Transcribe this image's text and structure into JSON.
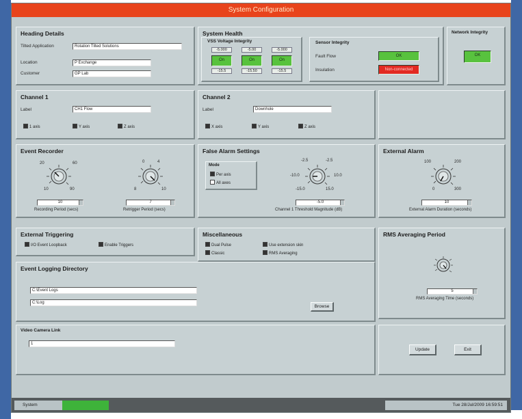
{
  "window": {
    "title": "System Configuration"
  },
  "heading_details": {
    "title": "Heading Details",
    "fields": [
      {
        "label": "Tilted Application",
        "value": "Rotation Tilted Solutions"
      },
      {
        "label": "Location",
        "value": "P Exchange"
      },
      {
        "label": "Customer",
        "value": "GP Lab"
      }
    ]
  },
  "system_health": {
    "title": "System Health",
    "voltage": {
      "title": "VSS Voltage Integrity",
      "top_values": [
        "-5.000",
        "-5.00",
        "-5.000"
      ],
      "states": [
        "On",
        "On",
        "On"
      ],
      "bottom_values": [
        "-15.5",
        "-15.50",
        "-15.5"
      ]
    },
    "sensor_integrity": {
      "title": "Sensor Integrity",
      "rows": [
        {
          "label": "Fault Flow",
          "state": "OK"
        },
        {
          "label": "Insulation",
          "state": "Non-connected"
        }
      ]
    },
    "network_integrity": {
      "title": "Network Integrity",
      "state": "OK"
    }
  },
  "channel1": {
    "title": "Channel 1",
    "label_caption": "Label",
    "label_value": "CH1 Flow",
    "options": [
      "1 axis",
      "Y axis",
      "Z axis"
    ]
  },
  "channel2": {
    "title": "Channel 2",
    "label_caption": "Label",
    "label_value": "Downhole",
    "options": [
      "X axis",
      "Y axis",
      "Z axis"
    ]
  },
  "event_recorder": {
    "title": "Event Recorder",
    "knob1": {
      "ticks": [
        "20",
        "60",
        "10",
        "90"
      ],
      "value": "10",
      "caption": "Recording Period (secs)"
    },
    "knob2": {
      "ticks": [
        "0",
        "4",
        "8",
        "10"
      ],
      "value": "7",
      "caption": "Retrigger Period (secs)"
    }
  },
  "false_alarm": {
    "title": "False Alarm Settings",
    "mode_title": "Mode",
    "modes": [
      "Per axis",
      "All axes"
    ],
    "knob": {
      "ticks": [
        "-2.5",
        "-2.5",
        "-10.0",
        "10.0",
        "-15.0",
        "15.0"
      ],
      "value": "-5.0",
      "caption": "Channel 1 Threshold Magnitude (dB)"
    }
  },
  "external_alarm": {
    "title": "External Alarm",
    "knob": {
      "ticks": [
        "100",
        "200",
        "0",
        "300"
      ],
      "value": "10",
      "caption": "External Alarm Duration (seconds)"
    }
  },
  "external_triggering": {
    "title": "External Triggering",
    "options": [
      "I/O Event Loopback",
      "Enable Triggers"
    ]
  },
  "miscellaneous": {
    "title": "Miscellaneous",
    "options_left": [
      "Dual Pulse",
      "Classic"
    ],
    "options_right": [
      "Use extension skin",
      "RMS Averaging"
    ]
  },
  "rms_period": {
    "title": "RMS Averaging Period",
    "knob": {
      "value": "5",
      "caption": "RMS Averaging Time (seconds)"
    }
  },
  "event_logging": {
    "title": "Event Logging Directory",
    "paths": [
      "C:\\Event Logs",
      "C:\\Log"
    ],
    "browse_label": "Browse"
  },
  "video_link": {
    "title": "Video Camera Link",
    "value": "1"
  },
  "actions": {
    "update_label": "Update",
    "exit_label": "Exit"
  },
  "status": {
    "label": "System",
    "datetime": "Tue 28/Jul/2009 16:59:51",
    "indicator_color": "#3eb33a"
  }
}
